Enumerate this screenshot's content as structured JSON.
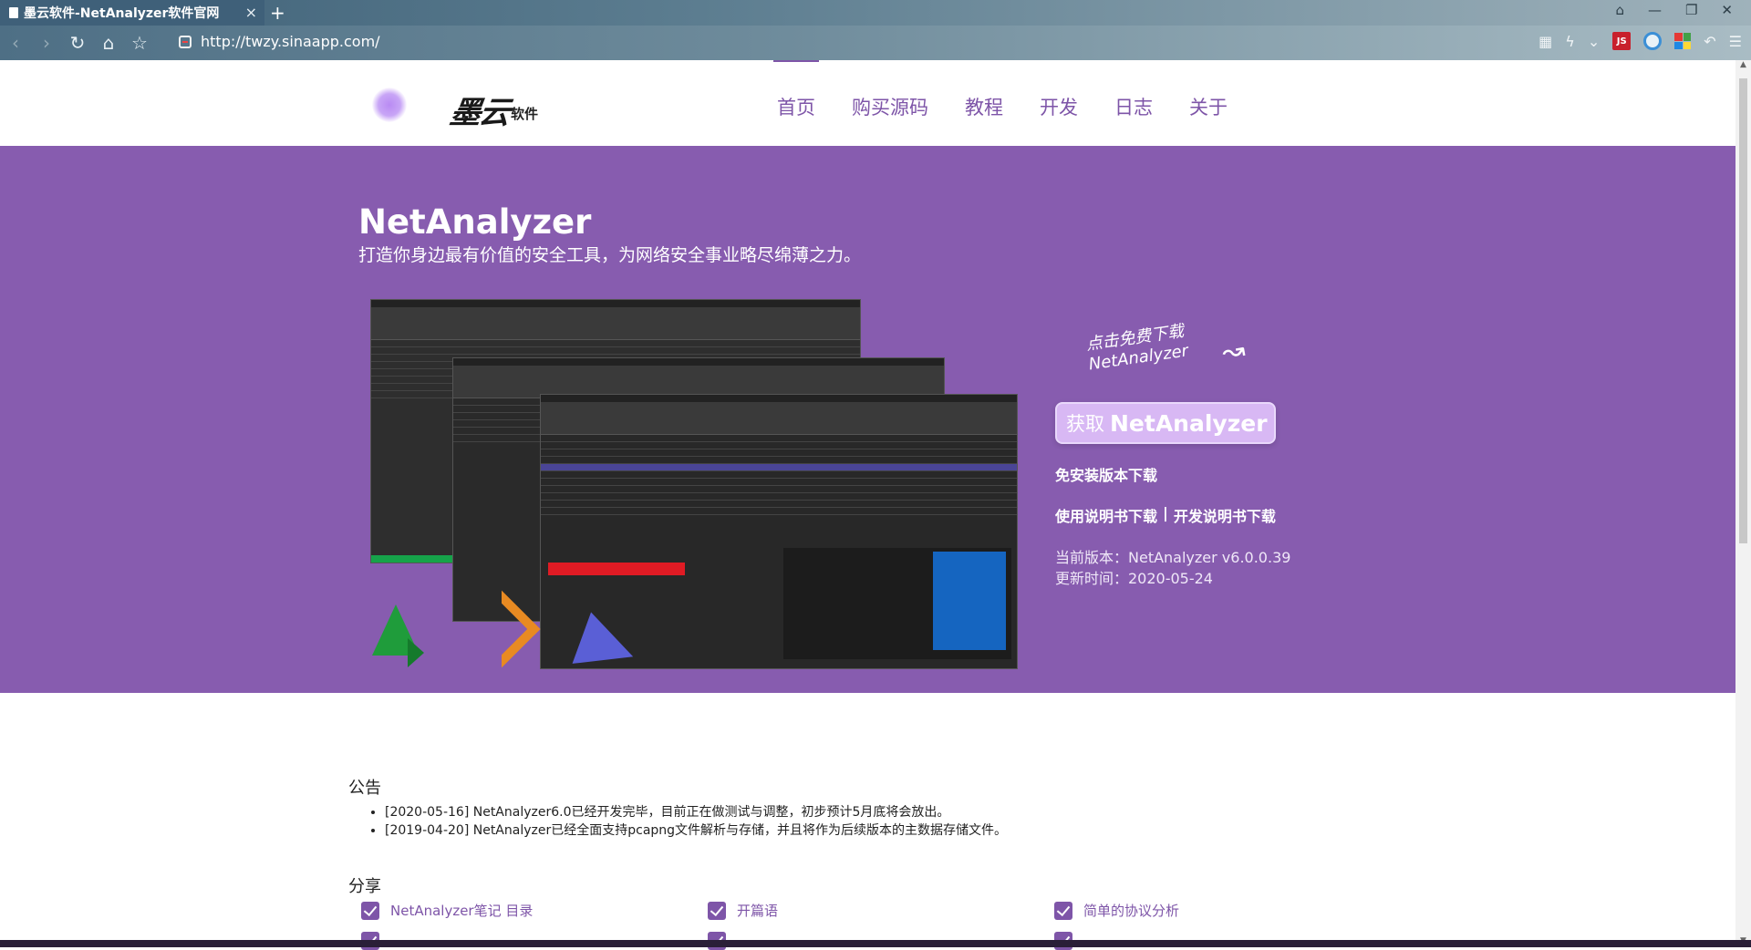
{
  "browser": {
    "tab_title": "墨云软件-NetAnalyzer软件官网",
    "tab_close": "×",
    "new_tab": "+",
    "url": "http://twzy.sinaapp.com/",
    "js_badge": "JS"
  },
  "site": {
    "logo_text": "墨云",
    "logo_sub": "软件",
    "nav": [
      "首页",
      "购买源码",
      "教程",
      "开发",
      "日志",
      "关于"
    ]
  },
  "hero": {
    "title": "NetAnalyzer",
    "subtitle": "打造你身边最有价值的安全工具，为网络安全事业略尽绵薄之力。",
    "hint_line1": "点击免费下载",
    "hint_line2": "NetAnalyzer",
    "cta_prefix": "获取",
    "cta_name": "NetAnalyzer",
    "download_portable": "免安装版本下载",
    "download_manual": "使用说明书下载",
    "download_separator": "|",
    "download_dev_manual": "开发说明书下载",
    "version": "当前版本：NetAnalyzer v6.0.0.39",
    "updated": "更新时间：2020-05-24"
  },
  "notice": {
    "title": "公告",
    "items": [
      "[2020-05-16] NetAnalyzer6.0已经开发完毕，目前正在做测试与调整，初步预计5月底将会放出。",
      "[2019-04-20] NetAnalyzer已经全面支持pcapng文件解析与存储，并且将作为后续版本的主数据存储文件。"
    ]
  },
  "share": {
    "title": "分享",
    "items": [
      "NetAnalyzer笔记 目录",
      "开篇语",
      "简单的协议分析"
    ]
  },
  "colors": {
    "accent": "#7e55a8",
    "hero_bg": "#875caf",
    "cta_bg": "#d8b8f4"
  }
}
